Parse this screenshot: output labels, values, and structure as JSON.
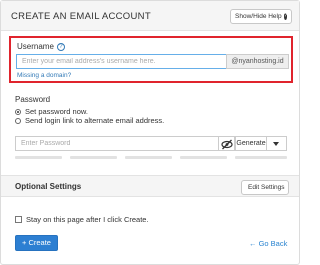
{
  "header": {
    "title": "CREATE AN EMAIL ACCOUNT",
    "help_button": "Show/Hide Help",
    "help_icon_glyph": "?"
  },
  "username": {
    "label": "Username",
    "help_glyph": "?",
    "placeholder": "Enter your email address's username here.",
    "value": "",
    "domain": "@nyanhosting.id",
    "missing_domain_link": "Missing a domain?"
  },
  "password": {
    "label": "Password",
    "options": [
      {
        "label": "Set password now.",
        "selected": true
      },
      {
        "label": "Send login link to alternate email address.",
        "selected": false
      }
    ],
    "placeholder": "Enter Password",
    "value": "",
    "generate_label": "Generate",
    "strength_segments": 5
  },
  "optional_settings": {
    "title": "Optional Settings",
    "edit_button": "Edit Settings"
  },
  "stay_on_page": {
    "label": "Stay on this page after I click Create.",
    "checked": false
  },
  "actions": {
    "create_label": "+ Create",
    "go_back_label": "← Go Back"
  },
  "colors": {
    "highlight_border": "#e0242d",
    "primary": "#2d7fd2",
    "link": "#337ab7"
  },
  "icons": [
    "help-icon",
    "question-icon",
    "eye-slash-icon",
    "caret-down-icon",
    "pencil-icon",
    "plus-icon",
    "arrow-left-icon"
  ]
}
